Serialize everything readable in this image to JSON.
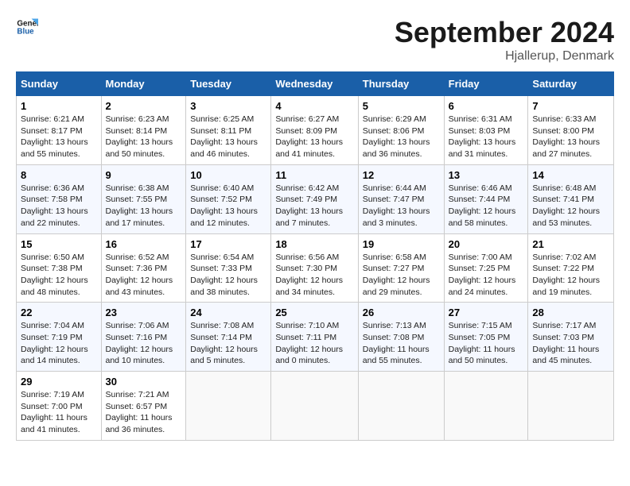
{
  "logo": {
    "line1": "General",
    "line2": "Blue"
  },
  "title": "September 2024",
  "location": "Hjallerup, Denmark",
  "days_of_week": [
    "Sunday",
    "Monday",
    "Tuesday",
    "Wednesday",
    "Thursday",
    "Friday",
    "Saturday"
  ],
  "weeks": [
    [
      {
        "day": "1",
        "sunrise": "6:21 AM",
        "sunset": "8:17 PM",
        "daylight": "13 hours and 55 minutes."
      },
      {
        "day": "2",
        "sunrise": "6:23 AM",
        "sunset": "8:14 PM",
        "daylight": "13 hours and 50 minutes."
      },
      {
        "day": "3",
        "sunrise": "6:25 AM",
        "sunset": "8:11 PM",
        "daylight": "13 hours and 46 minutes."
      },
      {
        "day": "4",
        "sunrise": "6:27 AM",
        "sunset": "8:09 PM",
        "daylight": "13 hours and 41 minutes."
      },
      {
        "day": "5",
        "sunrise": "6:29 AM",
        "sunset": "8:06 PM",
        "daylight": "13 hours and 36 minutes."
      },
      {
        "day": "6",
        "sunrise": "6:31 AM",
        "sunset": "8:03 PM",
        "daylight": "13 hours and 31 minutes."
      },
      {
        "day": "7",
        "sunrise": "6:33 AM",
        "sunset": "8:00 PM",
        "daylight": "13 hours and 27 minutes."
      }
    ],
    [
      {
        "day": "8",
        "sunrise": "6:36 AM",
        "sunset": "7:58 PM",
        "daylight": "13 hours and 22 minutes."
      },
      {
        "day": "9",
        "sunrise": "6:38 AM",
        "sunset": "7:55 PM",
        "daylight": "13 hours and 17 minutes."
      },
      {
        "day": "10",
        "sunrise": "6:40 AM",
        "sunset": "7:52 PM",
        "daylight": "13 hours and 12 minutes."
      },
      {
        "day": "11",
        "sunrise": "6:42 AM",
        "sunset": "7:49 PM",
        "daylight": "13 hours and 7 minutes."
      },
      {
        "day": "12",
        "sunrise": "6:44 AM",
        "sunset": "7:47 PM",
        "daylight": "13 hours and 3 minutes."
      },
      {
        "day": "13",
        "sunrise": "6:46 AM",
        "sunset": "7:44 PM",
        "daylight": "12 hours and 58 minutes."
      },
      {
        "day": "14",
        "sunrise": "6:48 AM",
        "sunset": "7:41 PM",
        "daylight": "12 hours and 53 minutes."
      }
    ],
    [
      {
        "day": "15",
        "sunrise": "6:50 AM",
        "sunset": "7:38 PM",
        "daylight": "12 hours and 48 minutes."
      },
      {
        "day": "16",
        "sunrise": "6:52 AM",
        "sunset": "7:36 PM",
        "daylight": "12 hours and 43 minutes."
      },
      {
        "day": "17",
        "sunrise": "6:54 AM",
        "sunset": "7:33 PM",
        "daylight": "12 hours and 38 minutes."
      },
      {
        "day": "18",
        "sunrise": "6:56 AM",
        "sunset": "7:30 PM",
        "daylight": "12 hours and 34 minutes."
      },
      {
        "day": "19",
        "sunrise": "6:58 AM",
        "sunset": "7:27 PM",
        "daylight": "12 hours and 29 minutes."
      },
      {
        "day": "20",
        "sunrise": "7:00 AM",
        "sunset": "7:25 PM",
        "daylight": "12 hours and 24 minutes."
      },
      {
        "day": "21",
        "sunrise": "7:02 AM",
        "sunset": "7:22 PM",
        "daylight": "12 hours and 19 minutes."
      }
    ],
    [
      {
        "day": "22",
        "sunrise": "7:04 AM",
        "sunset": "7:19 PM",
        "daylight": "12 hours and 14 minutes."
      },
      {
        "day": "23",
        "sunrise": "7:06 AM",
        "sunset": "7:16 PM",
        "daylight": "12 hours and 10 minutes."
      },
      {
        "day": "24",
        "sunrise": "7:08 AM",
        "sunset": "7:14 PM",
        "daylight": "12 hours and 5 minutes."
      },
      {
        "day": "25",
        "sunrise": "7:10 AM",
        "sunset": "7:11 PM",
        "daylight": "12 hours and 0 minutes."
      },
      {
        "day": "26",
        "sunrise": "7:13 AM",
        "sunset": "7:08 PM",
        "daylight": "11 hours and 55 minutes."
      },
      {
        "day": "27",
        "sunrise": "7:15 AM",
        "sunset": "7:05 PM",
        "daylight": "11 hours and 50 minutes."
      },
      {
        "day": "28",
        "sunrise": "7:17 AM",
        "sunset": "7:03 PM",
        "daylight": "11 hours and 45 minutes."
      }
    ],
    [
      {
        "day": "29",
        "sunrise": "7:19 AM",
        "sunset": "7:00 PM",
        "daylight": "11 hours and 41 minutes."
      },
      {
        "day": "30",
        "sunrise": "7:21 AM",
        "sunset": "6:57 PM",
        "daylight": "11 hours and 36 minutes."
      },
      null,
      null,
      null,
      null,
      null
    ]
  ]
}
